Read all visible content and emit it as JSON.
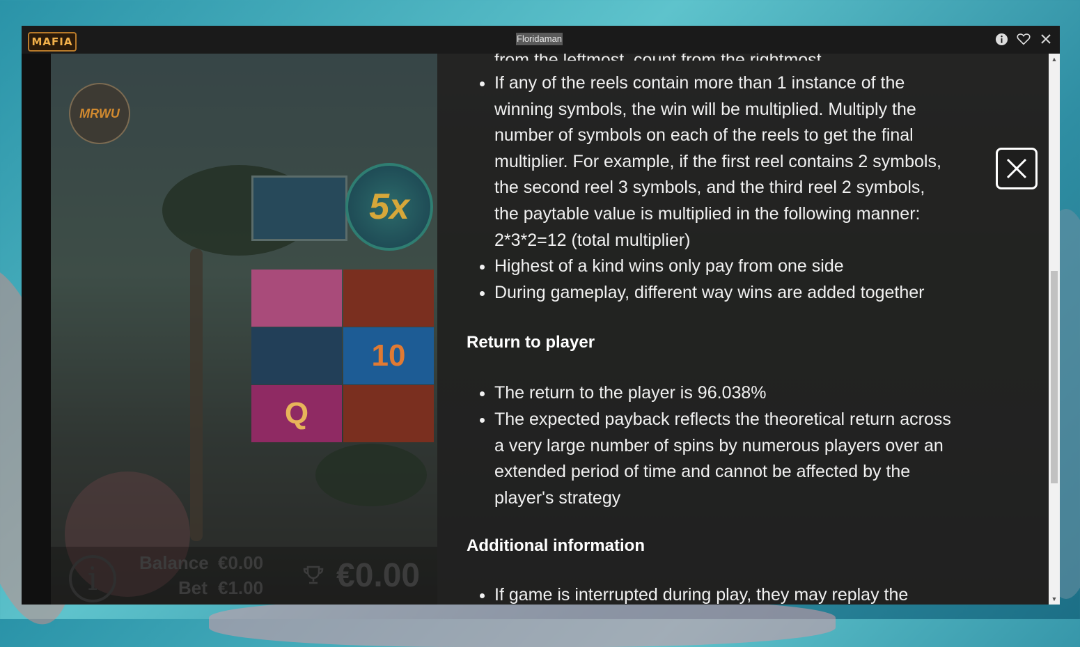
{
  "window": {
    "title": "Floridaman",
    "logo_text": "MAFIA",
    "icons": [
      "info-icon",
      "heart-icon",
      "close-icon"
    ]
  },
  "game": {
    "studio_badge": "MRWU",
    "multiplier_label": "5x",
    "cells": [
      "10",
      "Q"
    ],
    "balance_label": "Balance",
    "balance_value": "€0.00",
    "bet_label": "Bet",
    "bet_value": "€1.00",
    "win_value": "€0.00"
  },
  "rules": {
    "cutoff_line": "from the leftmost, count from the rightmost",
    "ways_items": [
      "If any of the reels contain more than 1 instance of the winning symbols, the win will be multiplied. Multiply the number of symbols on each of the reels to get the final multiplier. For example, if the first reel contains 2 symbols, the second reel 3 symbols, and the third reel 2 symbols, the paytable value is multiplied in the following manner: 2*3*2=12 (total multiplier)",
      "Highest of a kind wins only pay from one side",
      "During gameplay, different way wins are added together"
    ],
    "rtp_heading": "Return to player",
    "rtp_items": [
      "The return to the player is 96.038%",
      "The expected payback reflects the theoretical return across a very large number of spins by numerous players over an extended period of time and cannot be affected by the player's strategy"
    ],
    "additional_heading": "Additional information",
    "additional_items": [
      "If game is interrupted during play, they may replay the game"
    ]
  },
  "colors": {
    "panel_bg": "#202020",
    "text": "#f1f1f1",
    "logo_accent": "#f2b04a"
  }
}
